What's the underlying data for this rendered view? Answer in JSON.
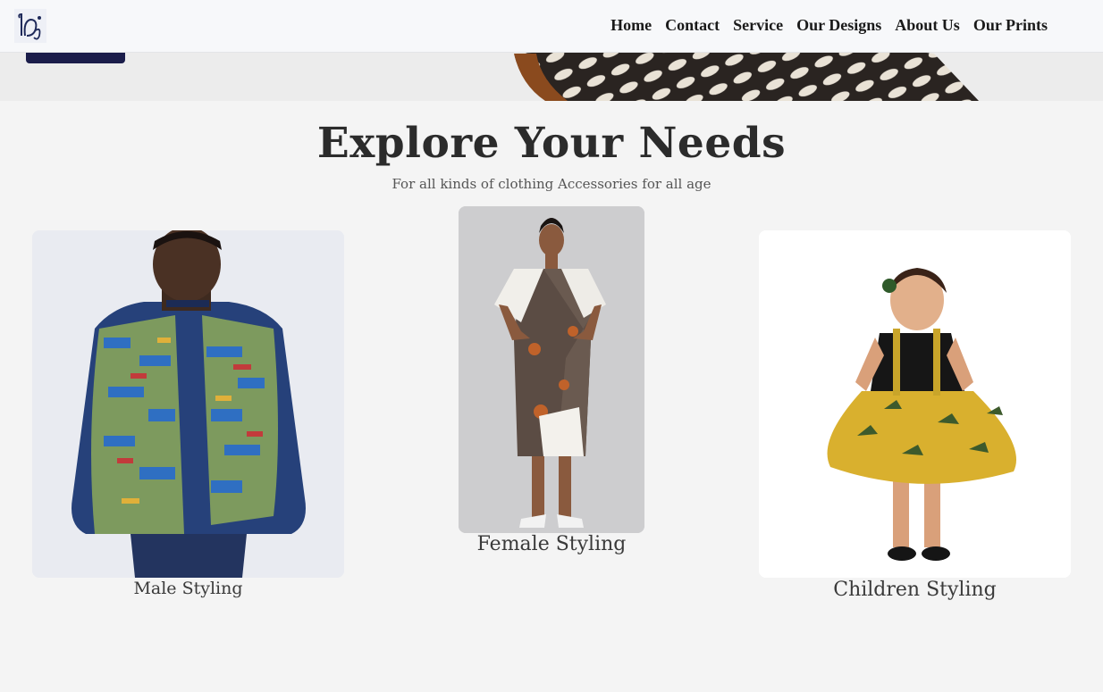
{
  "header": {
    "logo_icon": "brand-monogram-icon",
    "nav": [
      "Home",
      "Contact",
      "Service",
      "Our Designs",
      "About Us",
      "Our Prints"
    ]
  },
  "hero": {
    "image": "patterned-fabric-photo"
  },
  "section": {
    "title": "Explore Your Needs",
    "subtitle": "For all kinds of clothing Accessories for all age"
  },
  "cards": [
    {
      "label": "Male Styling",
      "image": "man-in-kente-patchwork-jacket-photo"
    },
    {
      "label": "Female Styling",
      "image": "woman-in-print-dress-photo"
    },
    {
      "label": "Children Styling",
      "image": "girl-in-yellow-print-skirt-photo"
    }
  ],
  "colors": {
    "nav_text": "#1a1a1a",
    "cta": "#1b1d4a",
    "page_bg": "#f4f4f4"
  }
}
